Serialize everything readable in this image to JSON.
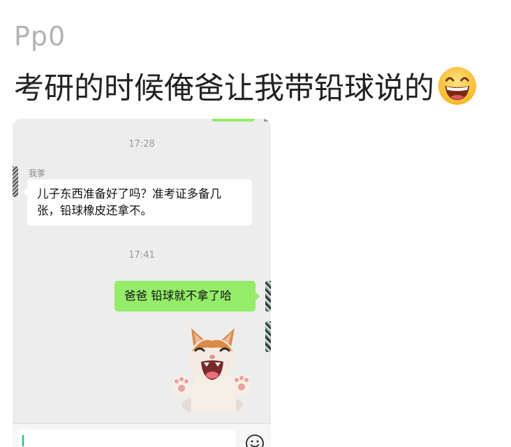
{
  "post": {
    "username": "Pp0",
    "title": "考研的时候俺爸让我带铅球说的"
  },
  "chat": {
    "timestamps": [
      "17:28",
      "17:41"
    ],
    "messages": [
      {
        "direction": "incoming",
        "sender": "我爹",
        "lines": [
          "儿子东西准备好了吗？准考证多备几",
          "张，铅球橡皮还拿不。"
        ]
      },
      {
        "direction": "outgoing",
        "text": "爸爸 铅球就不拿了哈"
      }
    ],
    "sticker": "laughing-cat-sticker"
  },
  "icons": {
    "title_emoji": "grinning-face-emoji",
    "input_emoji": "smiley-face-icon"
  },
  "colors": {
    "outgoing_bubble": "#95ec69",
    "incoming_bubble": "#ffffff",
    "chat_background": "#ededed",
    "username": "#b3b3b3",
    "title": "#222222"
  }
}
